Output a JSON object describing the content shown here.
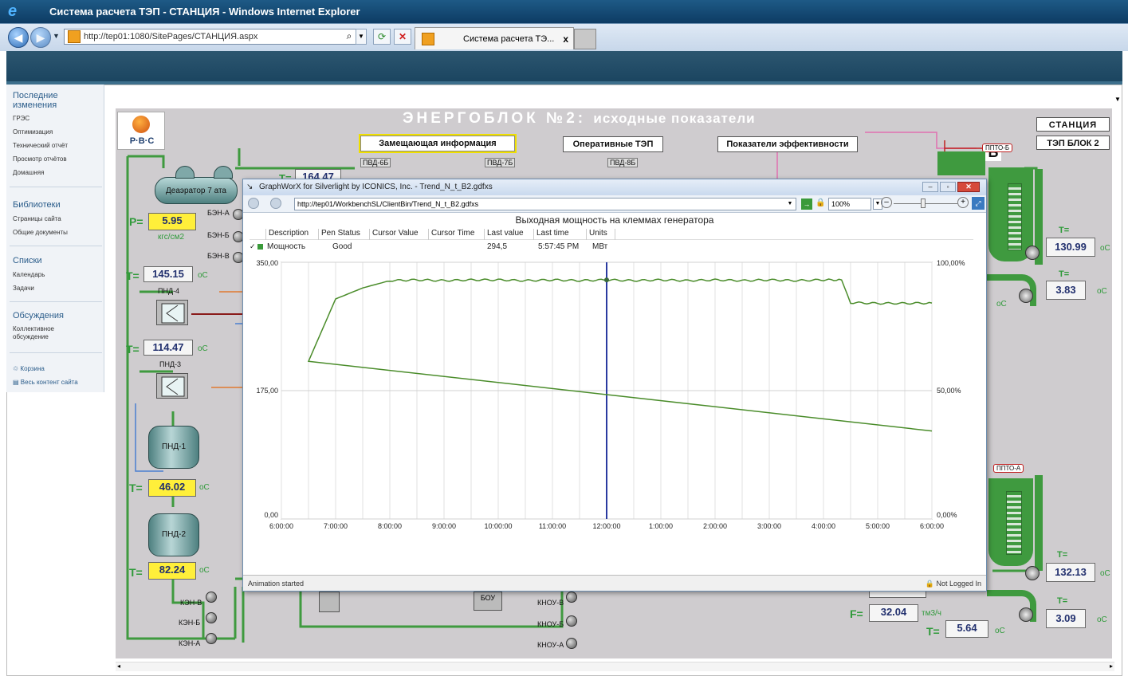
{
  "window": {
    "title": "Система расчета ТЭП - СТАНЦИЯ - Windows Internet Explorer"
  },
  "browser": {
    "url": "http://tep01:1080/SitePages/СТАНЦИЯ.aspx",
    "tab_label": "Система расчета ТЭ...",
    "tab_close": "x"
  },
  "leftnav": {
    "sections": [
      {
        "heading": "Последние изменения",
        "items": [
          "ГРЭС",
          "Оптимизация",
          "Технический отчёт",
          "Просмотр отчётов",
          "Домашняя"
        ]
      },
      {
        "heading": "Библиотеки",
        "items": [
          "Страницы сайта",
          "Общие документы"
        ]
      },
      {
        "heading": "Списки",
        "items": [
          "Календарь",
          "Задачи"
        ]
      },
      {
        "heading": "Обсуждения",
        "items": [
          "Коллективное обсуждение"
        ]
      }
    ],
    "footer": [
      "Корзина",
      "Весь контент сайта"
    ]
  },
  "scada": {
    "logo": "Р·В·С",
    "title": "ЭНЕРГОБЛОК №2:",
    "subtitle": "исходные показатели",
    "buttons": {
      "zam": "Замещающая информация",
      "oper": "Оперативные ТЭП",
      "eff": "Показатели эффективности",
      "station": "СТАНЦИЯ",
      "block": "ТЭП БЛОК 2"
    },
    "deaerator": "Деаэратор 7 ата",
    "pvd": [
      "ПВД-6Б",
      "ПВД-7Б",
      "ПВД-8Б"
    ],
    "ben": [
      "БЭН-А",
      "БЭН-Б",
      "БЭН-В"
    ],
    "p_label": "P=",
    "p_value": "5.95",
    "p_unit": "кгс/см2",
    "t_label": "T=",
    "t_unit": "оС",
    "f_label": "F=",
    "f_unit": "тм3/ч",
    "t_partial": "164.47",
    "pnd4": "ПНД-4",
    "pnd3": "ПНД-3",
    "pnd1": "ПНД-1",
    "pnd2": "ПНД-2",
    "t1": "145.15",
    "t2": "114.47",
    "t3": "46.02",
    "t4": "82.24",
    "ken": [
      "КЭН-В",
      "КЭН-Б",
      "КЭН-А"
    ],
    "knou": [
      "КНОУ-В",
      "КНОУ-Б",
      "КНОУ-А"
    ],
    "bou": "БОУ",
    "ppto_b": "ППТО-Б",
    "ppto_a": "ППТО-А",
    "block_digit": "Б",
    "r1": "130.99",
    "r2": "3.83",
    "r3": "132.13",
    "r4": "3.09",
    "f_value": "32.04",
    "t_bottom": "5.64"
  },
  "popup": {
    "title": "GraphWorX for Silverlight by ICONICS, Inc. - Trend_N_t_B2.gdfxs",
    "url": "http://tep01/WorkbenchSL/ClientBin/Trend_N_t_B2.gdfxs",
    "zoom": "100%",
    "chart_title": "Выходная мощность на клеммах генератора",
    "columns": [
      "Description",
      "Pen Status",
      "Cursor Value",
      "Cursor Time",
      "Last value",
      "Last time",
      "Units"
    ],
    "row": {
      "description": "Мощность",
      "status": "Good",
      "cursor_value": "",
      "cursor_time": "",
      "last_value": "294,5",
      "last_time": "5:57:45 PM",
      "units": "МВт"
    },
    "status_left": "Animation started",
    "status_right": "Not Logged In"
  },
  "chart_data": {
    "type": "line",
    "title": "Выходная мощность на клеммах генератора",
    "x": [
      "6:00:00",
      "6:30:00",
      "7:00:00",
      "7:30:00",
      "8:00:00",
      "8:30:00",
      "9:00:00",
      "9:30:00",
      "10:00:00",
      "10:30:00",
      "11:00:00",
      "11:30:00",
      "12:00:00",
      "12:30:00",
      "1:00:00",
      "1:30:00",
      "2:00:00",
      "2:30:00",
      "3:00:00",
      "3:30:00",
      "4:00:00",
      "4:20:00",
      "4:30:00",
      "5:00:00",
      "5:30:00",
      "6:00:00"
    ],
    "series": [
      {
        "name": "Мощность",
        "color": "#4a8c2a",
        "values": [
          120,
          215,
          300,
          315,
          325,
          326,
          325,
          326,
          326,
          325,
          326,
          325,
          326,
          325,
          326,
          325,
          326,
          325,
          326,
          325,
          326,
          326,
          295,
          294,
          294,
          294.5
        ]
      }
    ],
    "xticks": [
      "6:00:00",
      "7:00:00",
      "8:00:00",
      "9:00:00",
      "10:00:00",
      "11:00:00",
      "12:00:00",
      "1:00:00",
      "2:00:00",
      "3:00:00",
      "4:00:00",
      "5:00:00",
      "6:00:00"
    ],
    "yticks_left": [
      "0,00",
      "175,00",
      "350,00"
    ],
    "yticks_right": [
      "0,00%",
      "50,00%",
      "100,00%"
    ],
    "ylim": [
      0,
      350
    ],
    "cursor_x": "12:00:00",
    "grid": true
  }
}
